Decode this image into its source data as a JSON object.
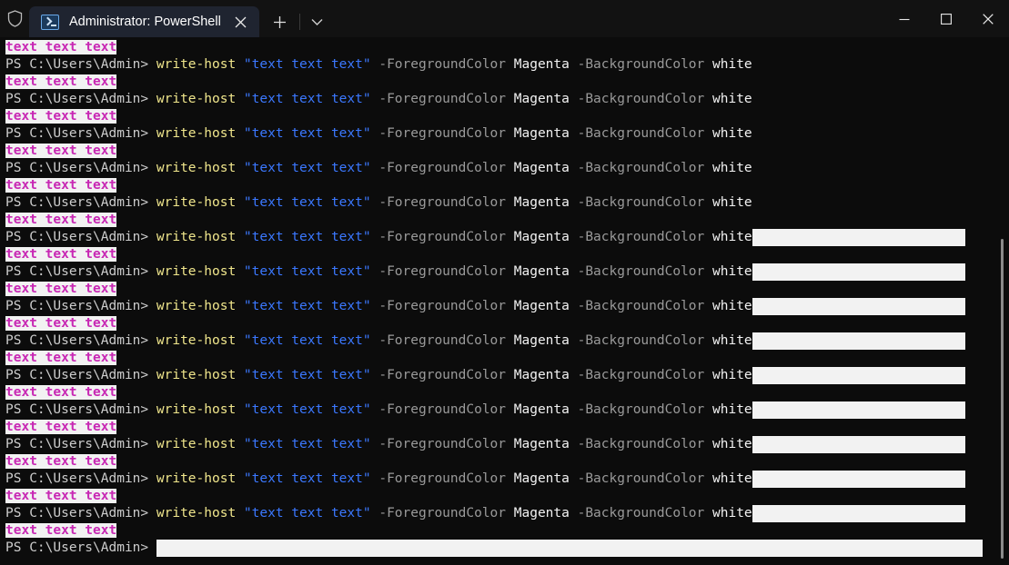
{
  "window": {
    "title": "Administrator: PowerShell",
    "shield_icon": "shield-icon",
    "tab_icon": "powershell-icon",
    "close_tab_icon": "close-icon",
    "new_tab_icon": "plus-icon",
    "tab_dropdown_icon": "chevron-down-icon",
    "minimize_icon": "minimize-icon",
    "maximize_icon": "maximize-icon",
    "close_icon": "close-icon",
    "background_color": "#0c0c0c",
    "titlebar_color": "#121212",
    "tab_color": "#1f2430"
  },
  "terminal": {
    "prompt": "PS C:\\Users\\Admin> ",
    "prompt_bare": "PS C:\\Users\\Admin>",
    "command": {
      "verb": "write-host",
      "space": " ",
      "string": "\"text text text\"",
      "param_fg": " -ForegroundColor ",
      "value_fg": "Magenta",
      "param_bg": " -BackgroundColor ",
      "value_bg": "white"
    },
    "output_text": "text text text",
    "colors": {
      "output_fg": "#c828b4",
      "output_bg": "#f2f2f2",
      "prompt_fg": "#cccccc",
      "verb_fg": "#f0e68c",
      "string_fg": "#3b78ff",
      "param_fg": "#9a9a9a",
      "value_fg": "#f2f2f2",
      "selection_bg": "#f2f2f2",
      "scrollbar_fg": "#8a8a8a"
    },
    "lines": [
      {
        "type": "output",
        "selected": false
      },
      {
        "type": "command",
        "selected": false
      },
      {
        "type": "output",
        "selected": false
      },
      {
        "type": "command",
        "selected": false
      },
      {
        "type": "output",
        "selected": false
      },
      {
        "type": "command",
        "selected": false
      },
      {
        "type": "output",
        "selected": false
      },
      {
        "type": "command",
        "selected": false
      },
      {
        "type": "output",
        "selected": false
      },
      {
        "type": "command",
        "selected": false
      },
      {
        "type": "output",
        "selected": false
      },
      {
        "type": "command",
        "selected": true
      },
      {
        "type": "output",
        "selected": false
      },
      {
        "type": "command",
        "selected": true
      },
      {
        "type": "output",
        "selected": false
      },
      {
        "type": "command",
        "selected": true
      },
      {
        "type": "output",
        "selected": false
      },
      {
        "type": "command",
        "selected": true
      },
      {
        "type": "output",
        "selected": false
      },
      {
        "type": "command",
        "selected": true
      },
      {
        "type": "output",
        "selected": false
      },
      {
        "type": "command",
        "selected": true
      },
      {
        "type": "output",
        "selected": false
      },
      {
        "type": "command",
        "selected": true
      },
      {
        "type": "output",
        "selected": false
      },
      {
        "type": "command",
        "selected": true
      },
      {
        "type": "output",
        "selected": false
      },
      {
        "type": "command",
        "selected": true
      },
      {
        "type": "output",
        "selected": false
      },
      {
        "type": "prompt_only",
        "selected": true
      }
    ]
  }
}
